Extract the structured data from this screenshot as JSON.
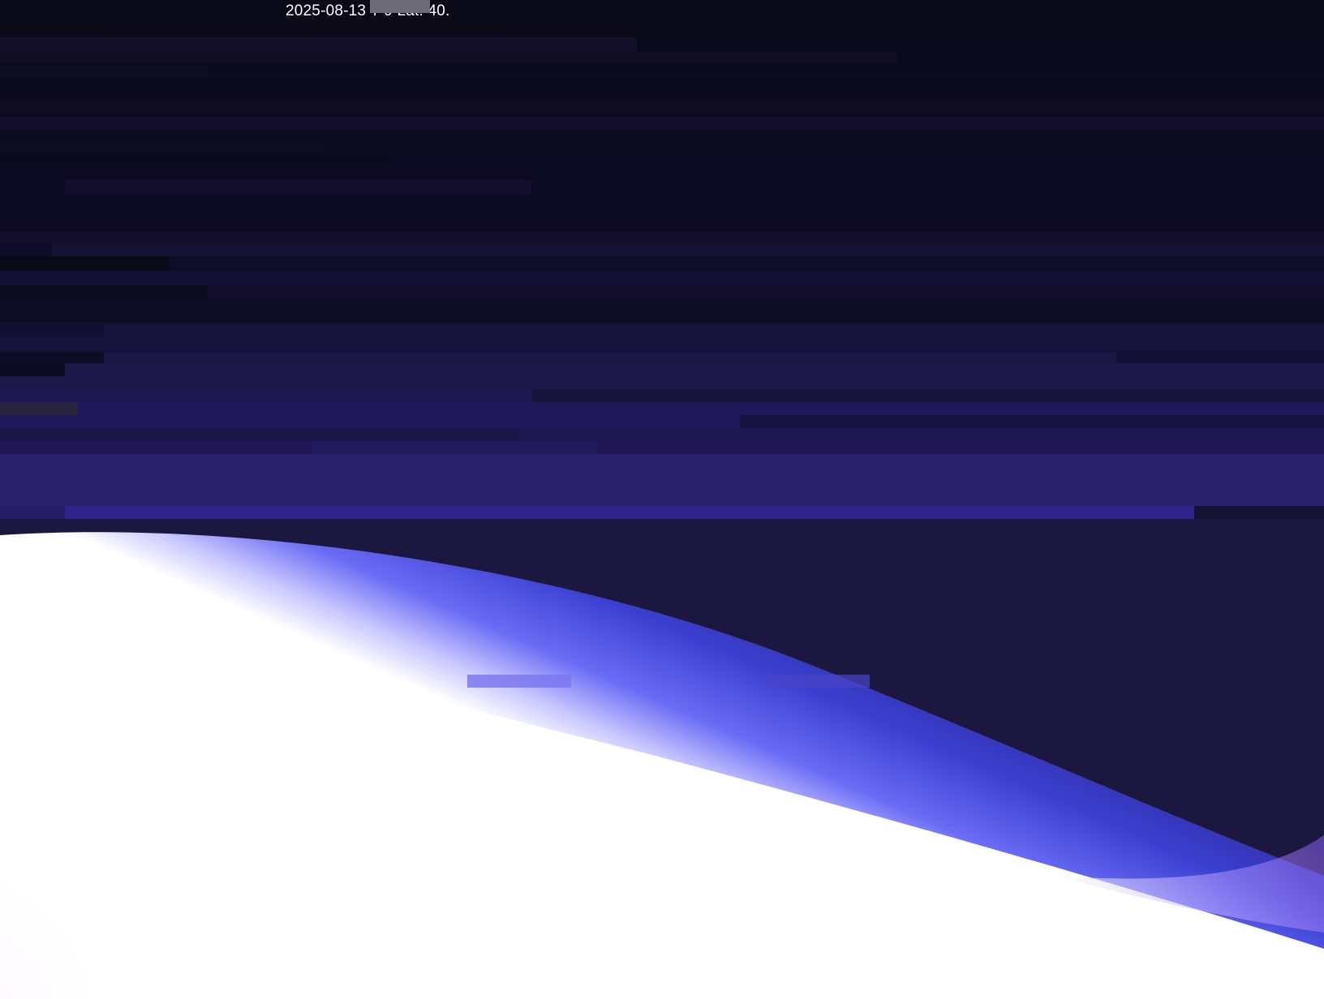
{
  "photo": {
    "subject": "Earth limb from high altitude",
    "overlay_text": "2025-08-13 T 9 Lat: 40.",
    "overlay_visible_fragment_left": "2025 08 13",
    "overlay_visible_fragment_right": "9 Lat: 40 :",
    "redacted": true
  },
  "colors": {
    "space": "#0a0a18",
    "upper_sky": "#110e28",
    "band_purple": "#2a1f6a",
    "limb_blue": "#3b3cc9",
    "limb_violet": "#8a5cf0",
    "earth_white": "#ffffff",
    "redaction": "#6e6b78"
  }
}
